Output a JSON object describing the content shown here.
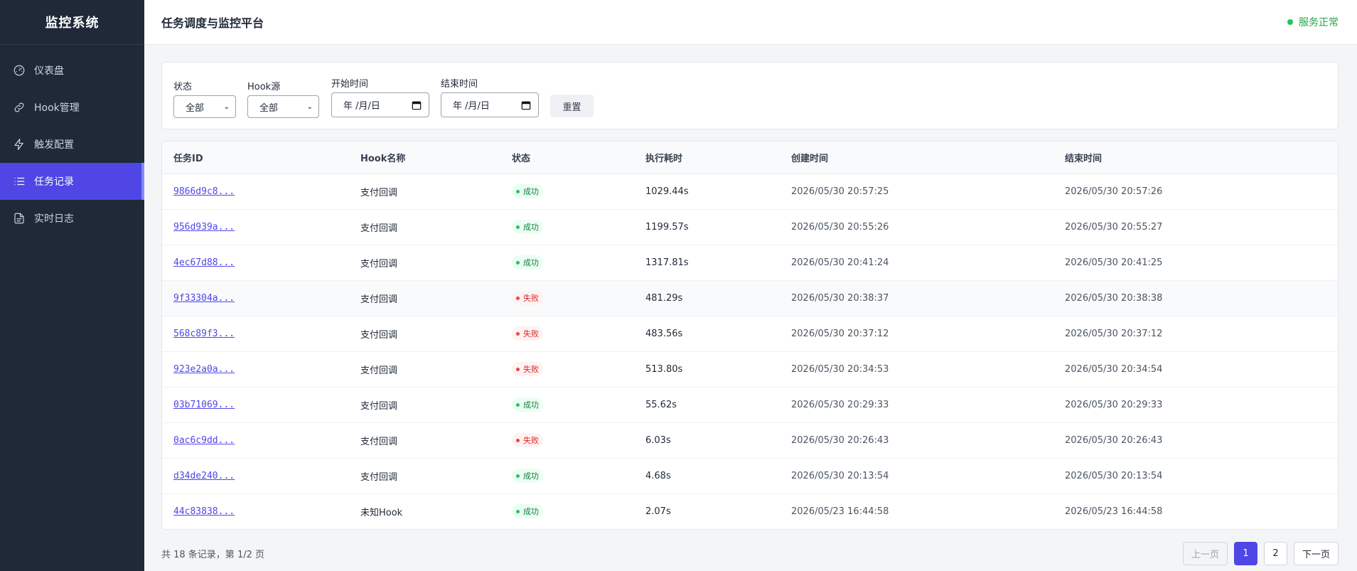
{
  "brand": "监控系统",
  "sidebar": {
    "items": [
      {
        "label": "仪表盘",
        "icon": "gauge-icon"
      },
      {
        "label": "Hook管理",
        "icon": "link-icon"
      },
      {
        "label": "触发配置",
        "icon": "lightning-icon"
      },
      {
        "label": "任务记录",
        "icon": "list-icon",
        "active": true
      },
      {
        "label": "实时日志",
        "icon": "document-icon"
      }
    ]
  },
  "header": {
    "title": "任务调度与监控平台",
    "status": "服务正常",
    "status_color": "#22c55e"
  },
  "filters": {
    "status_label": "状态",
    "status_value": "全部",
    "hook_label": "Hook源",
    "hook_value": "全部",
    "start_label": "开始时间",
    "start_value": "年 /月/日",
    "end_label": "结束时间",
    "end_value": "年 /月/日",
    "reset_label": "重置"
  },
  "table": {
    "columns": [
      "任务ID",
      "Hook名称",
      "状态",
      "执行耗时",
      "创建时间",
      "结束时间"
    ],
    "rows": [
      {
        "id": "9866d9c8...",
        "hook": "支付回调",
        "status": "成功",
        "duration": "1029.44s",
        "created": "2026/05/30 20:57:25",
        "ended": "2026/05/30 20:57:26"
      },
      {
        "id": "956d939a...",
        "hook": "支付回调",
        "status": "成功",
        "duration": "1199.57s",
        "created": "2026/05/30 20:55:26",
        "ended": "2026/05/30 20:55:27"
      },
      {
        "id": "4ec67d88...",
        "hook": "支付回调",
        "status": "成功",
        "duration": "1317.81s",
        "created": "2026/05/30 20:41:24",
        "ended": "2026/05/30 20:41:25"
      },
      {
        "id": "9f33304a...",
        "hook": "支付回调",
        "status": "失败",
        "duration": "481.29s",
        "created": "2026/05/30 20:38:37",
        "ended": "2026/05/30 20:38:38"
      },
      {
        "id": "568c89f3...",
        "hook": "支付回调",
        "status": "失败",
        "duration": "483.56s",
        "created": "2026/05/30 20:37:12",
        "ended": "2026/05/30 20:37:12"
      },
      {
        "id": "923e2a0a...",
        "hook": "支付回调",
        "status": "失败",
        "duration": "513.80s",
        "created": "2026/05/30 20:34:53",
        "ended": "2026/05/30 20:34:54"
      },
      {
        "id": "03b71069...",
        "hook": "支付回调",
        "status": "成功",
        "duration": "55.62s",
        "created": "2026/05/30 20:29:33",
        "ended": "2026/05/30 20:29:33"
      },
      {
        "id": "0ac6c9dd...",
        "hook": "支付回调",
        "status": "失败",
        "duration": "6.03s",
        "created": "2026/05/30 20:26:43",
        "ended": "2026/05/30 20:26:43"
      },
      {
        "id": "d34de240...",
        "hook": "支付回调",
        "status": "成功",
        "duration": "4.68s",
        "created": "2026/05/30 20:13:54",
        "ended": "2026/05/30 20:13:54"
      },
      {
        "id": "44c83838...",
        "hook": "未知Hook",
        "status": "成功",
        "duration": "2.07s",
        "created": "2026/05/23 16:44:58",
        "ended": "2026/05/23 16:44:58"
      }
    ]
  },
  "footer": {
    "summary": "共 18 条记录，第 1/2 页",
    "prev": "上一页",
    "pages": [
      "1",
      "2"
    ],
    "current_page": "1",
    "next": "下一页"
  }
}
